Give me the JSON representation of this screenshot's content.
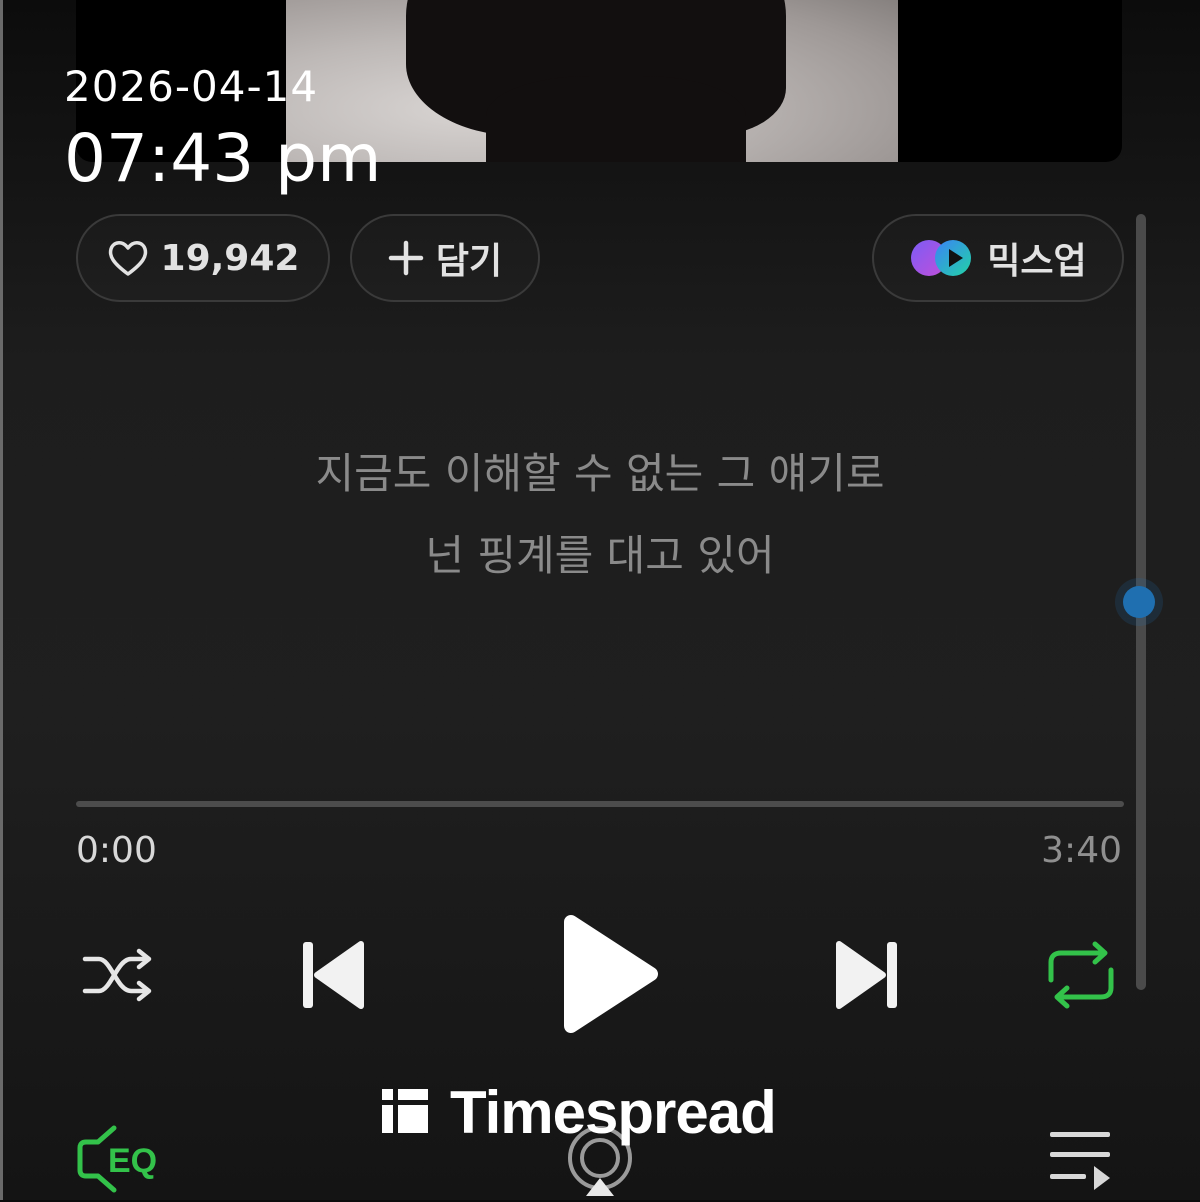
{
  "overlay": {
    "date": "2026-04-14",
    "time": "07:43 pm"
  },
  "actions": {
    "like_count": "19,942",
    "add_label": "담기",
    "mixup_label": "믹스업"
  },
  "lyrics": {
    "line1": "지금도 이해할 수 없는 그 얘기로",
    "line2": "넌 핑계를 대고 있어"
  },
  "playback": {
    "current_time": "0:00",
    "total_time": "3:40",
    "progress_fraction": 0.0,
    "repeat_active": true,
    "shuffle_active": false
  },
  "bottom_bar": {
    "eq_label": "EQ"
  },
  "watermark": {
    "text": "Timespread"
  },
  "colors": {
    "accent_green": "#33c24a",
    "scroll_thumb": "#1f6fb0",
    "mixup_purple": "#8b5cf6",
    "mixup_blue": "#3b82f6"
  },
  "icons": [
    "heart-icon",
    "plus-icon",
    "mixup-logo-icon",
    "shuffle-icon",
    "previous-icon",
    "play-icon",
    "next-icon",
    "repeat-icon",
    "eq-icon",
    "airplay-icon",
    "playlist-icon"
  ]
}
